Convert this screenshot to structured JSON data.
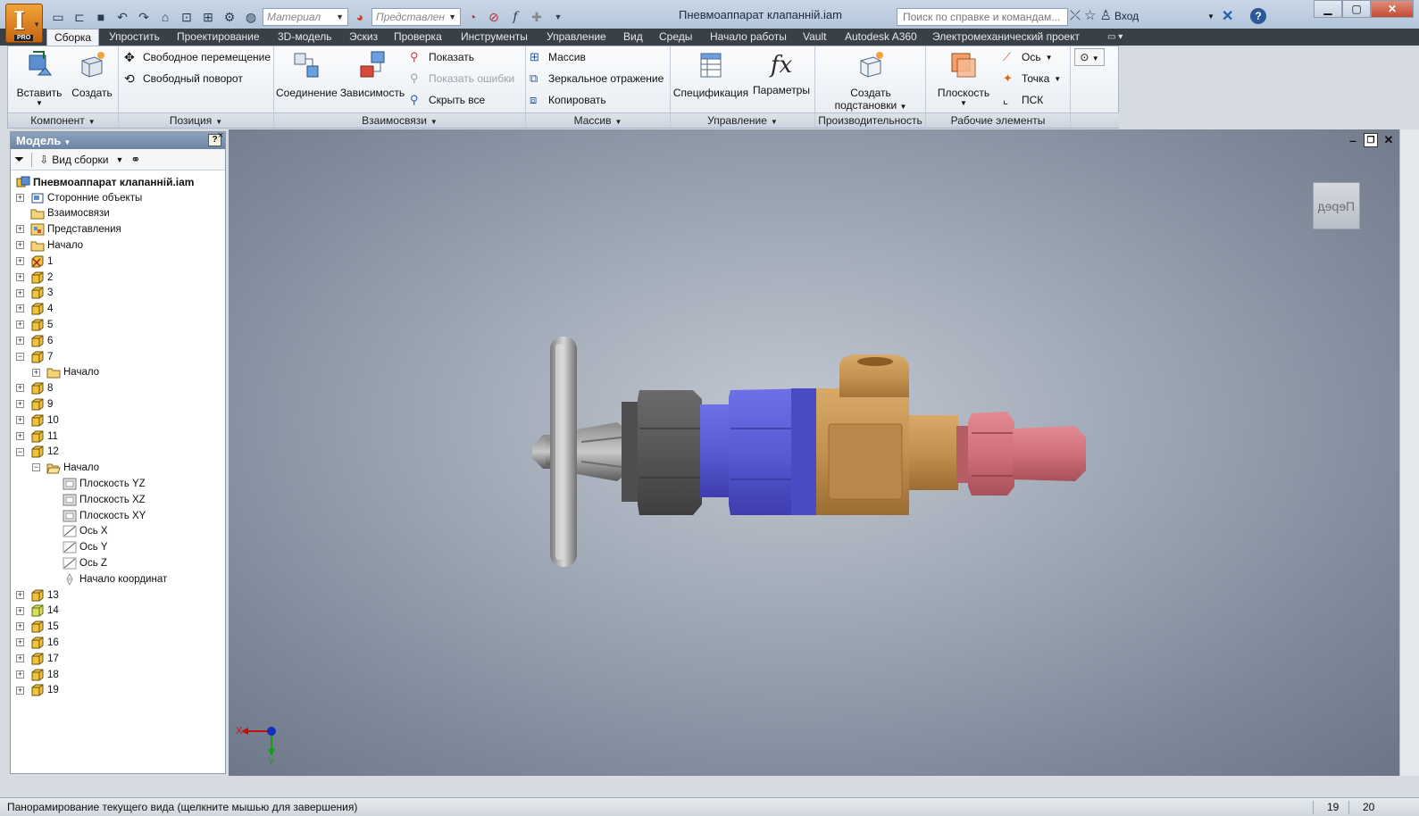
{
  "titlebar": {
    "document_title": "Пневмоаппарат клапанній.iam",
    "material_placeholder": "Материал",
    "appearance_placeholder": "Представлен",
    "search_placeholder": "Поиск по справке и командам...",
    "signin_label": "Вход"
  },
  "tabs": [
    "Сборка",
    "Упростить",
    "Проектирование",
    "3D-модель",
    "Эскиз",
    "Проверка",
    "Инструменты",
    "Управление",
    "Вид",
    "Среды",
    "Начало работы",
    "Vault",
    "Autodesk A360",
    "Электромеханический проект"
  ],
  "ribbon": {
    "component": {
      "title": "Компонент",
      "insert": "Вставить",
      "create": "Создать"
    },
    "position": {
      "title": "Позиция",
      "free_move": "Свободное перемещение",
      "free_rotate": "Свободный поворот"
    },
    "relations": {
      "title": "Взаимосвязи",
      "joint": "Соединение",
      "constraint": "Зависимость",
      "show": "Показать",
      "show_errors": "Показать ошибки",
      "hide_all": "Скрыть все"
    },
    "pattern": {
      "title": "Массив",
      "pattern": "Массив",
      "mirror": "Зеркальное отражение",
      "copy": "Копировать"
    },
    "manage": {
      "title": "Управление",
      "bom": "Спецификация",
      "params": "Параметры"
    },
    "productivity": {
      "title": "Производительность",
      "substitutes_1": "Создать",
      "substitutes_2": "подстановки"
    },
    "work_features": {
      "title": "Рабочие элементы",
      "plane": "Плоскость",
      "axis": "Ось",
      "point": "Точка",
      "ucs": "ПСК"
    }
  },
  "browser": {
    "title": "Модель",
    "view_label": "Вид сборки",
    "root": "Пневмоаппарат клапанній.iam",
    "nodes": {
      "third_party": "Сторонние объекты",
      "relations": "Взаимосвязи",
      "representations": "Представления",
      "origin": "Начало",
      "c1": "1",
      "c2": "2",
      "c3": "3",
      "c4": "4",
      "c5": "5",
      "c6": "6",
      "c7": "7",
      "c7_origin": "Начало",
      "c8": "8",
      "c9": "9",
      "c10": "10",
      "c11": "11",
      "c12": "12",
      "c12_origin": "Начало",
      "plane_yz": "Плоскость YZ",
      "plane_xz": "Плоскость XZ",
      "plane_xy": "Плоскость XY",
      "axis_x": "Ось X",
      "axis_y": "Ось Y",
      "axis_z": "Ось Z",
      "center": "Начало координат",
      "c13": "13",
      "c14": "14",
      "c15": "15",
      "c16": "16",
      "c17": "17",
      "c18": "18",
      "c19": "19"
    }
  },
  "viewport": {
    "viewcube_label": "Перед",
    "triad_x": "X",
    "triad_y": "Y"
  },
  "status": {
    "message": "Панорамирование текущего вида (щелкните мышью для завершения)",
    "count_1": "19",
    "count_2": "20"
  },
  "colors": {
    "handwheel": "#a8a8a8",
    "nut": "#5a5a5a",
    "blue_body": "#5a5ad2",
    "brass_body": "#c39150",
    "pink_fitting": "#d0707a"
  }
}
